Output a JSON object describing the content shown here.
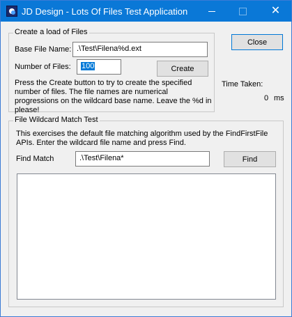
{
  "window": {
    "title": "JD Design - Lots Of Files Test Application",
    "icon": "app-icon",
    "controls": {
      "minimize": "minimize-icon",
      "maximize": "maximize-icon",
      "close": "close-icon"
    }
  },
  "create_group": {
    "label": "Create a load of Files",
    "base_file_name_label": "Base File Name:",
    "base_file_name_value": ".\\Test\\Filena%d.ext",
    "number_of_files_label": "Number of Files:",
    "number_of_files_value": "100",
    "create_button": "Create",
    "description": "Press the Create button to try to create the specified number of files. The file names are numerical progressions on the wildcard base name. Leave the %d in please!"
  },
  "close_button": "Close",
  "time_taken": {
    "label": "Time Taken:",
    "value": "0",
    "unit": "ms"
  },
  "match_group": {
    "label": "File Wildcard Match Test",
    "description": "This exercises the default file matching algorithm used by the FindFirstFile APIs. Enter the wildcard file name and press Find.",
    "find_match_label": "Find Match",
    "find_match_value": ".\\Test\\Filena*",
    "find_button": "Find",
    "results": []
  },
  "colors": {
    "titlebar": "#0a78d7",
    "window_bg": "#f0f0f0",
    "selection": "#0078d7"
  }
}
